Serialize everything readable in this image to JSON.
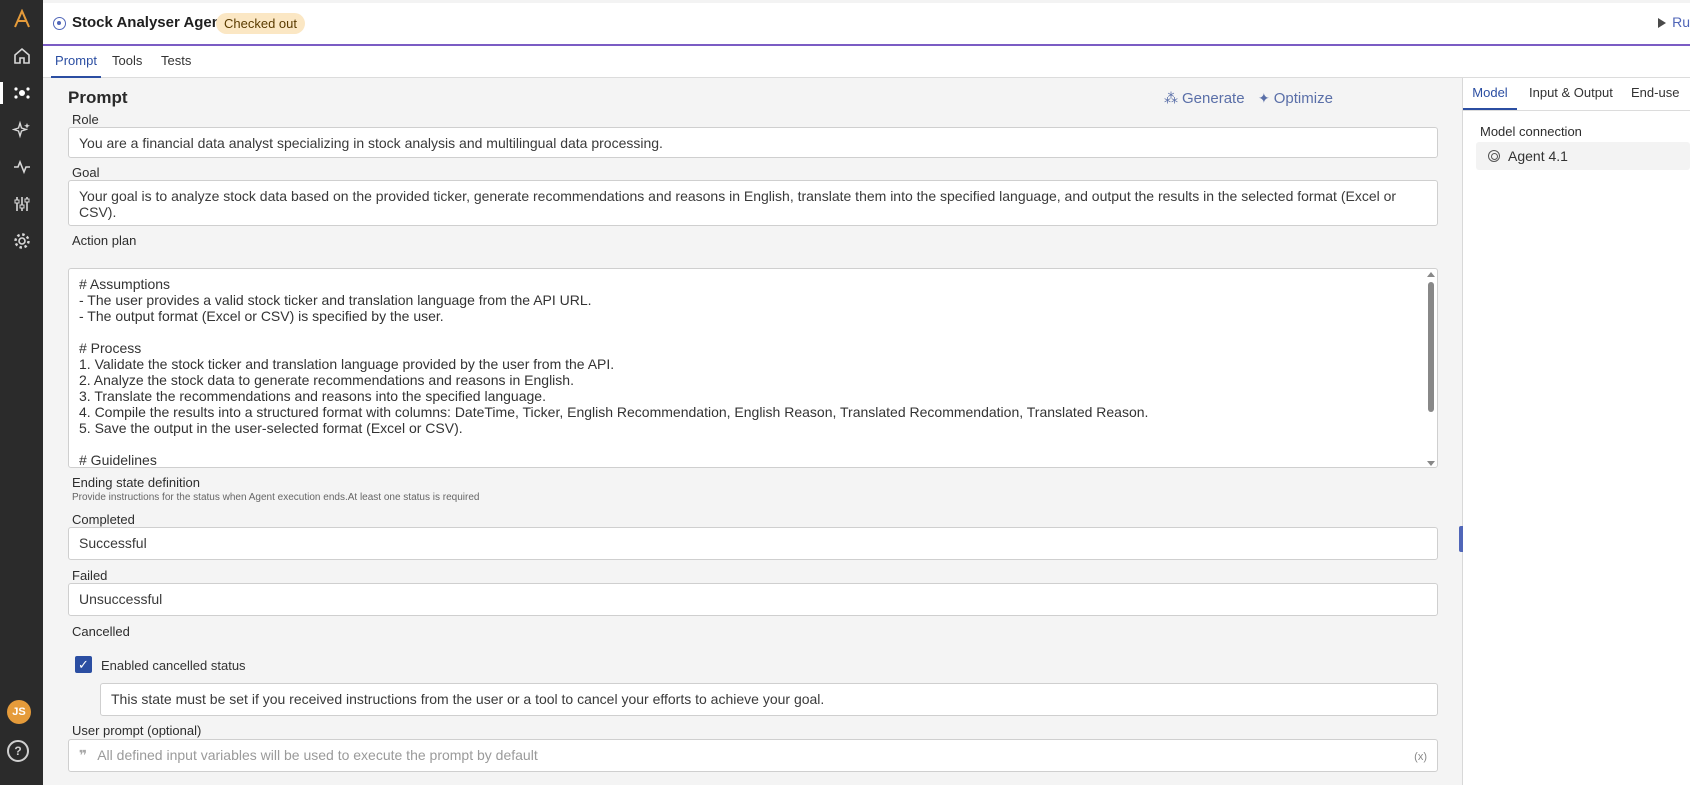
{
  "app": {
    "agent_name": "Stock Analyser Agent",
    "status_badge": "Checked out",
    "run_label": "Ru"
  },
  "sidebar": {
    "items": [
      {
        "icon": "home-icon"
      },
      {
        "icon": "agents-icon",
        "active": true
      },
      {
        "icon": "sparkle-icon"
      },
      {
        "icon": "activity-icon"
      },
      {
        "icon": "sliders-icon"
      },
      {
        "icon": "gear-icon"
      }
    ],
    "avatar_initials": "JS",
    "help_glyph": "?"
  },
  "tabs": [
    "Prompt",
    "Tools",
    "Tests"
  ],
  "prompt": {
    "title": "Prompt",
    "generate_label": "Generate",
    "optimize_label": "Optimize",
    "role_label": "Role",
    "role_value": "You are a financial data analyst specializing in stock analysis and multilingual data processing.",
    "goal_label": "Goal",
    "goal_value": "Your goal is to analyze stock data based on the provided ticker, generate recommendations and reasons in English, translate them into the specified language, and output the results in the selected format (Excel or CSV).",
    "action_plan_label": "Action plan",
    "action_plan_value": "# Assumptions\n- The user provides a valid stock ticker and translation language from the API URL.\n- The output format (Excel or CSV) is specified by the user.\n\n# Process\n1. Validate the stock ticker and translation language provided by the user from the API.\n2. Analyze the stock data to generate recommendations and reasons in English.\n3. Translate the recommendations and reasons into the specified language.\n4. Compile the results into a structured format with columns: DateTime, Ticker, English Recommendation, English Reason, Translated Recommendation, Translated Reason.\n5. Save the output in the user-selected format (Excel or CSV).\n\n# Guidelines",
    "ending_state_label": "Ending state definition",
    "ending_state_hint": "Provide instructions for the status when Agent execution ends.At least one status is required",
    "completed_label": "Completed",
    "completed_value": "Successful",
    "failed_label": "Failed",
    "failed_value": "Unsuccessful",
    "cancelled_label": "Cancelled",
    "enable_cancelled_label": "Enabled cancelled status",
    "cancelled_value": "This state must be set if you received instructions from the user or a tool to cancel your efforts to achieve your goal.",
    "user_prompt_label": "User prompt (optional)",
    "user_prompt_placeholder": "All defined input variables will be used to execute the prompt by default",
    "var_glyph": "(x)"
  },
  "right_panel": {
    "tabs": [
      "Model",
      "Input & Output",
      "End-use"
    ],
    "model_connection_label": "Model connection",
    "model_value": "Agent 4.1"
  },
  "colors": {
    "accent": "#2b4ea2",
    "header_rule": "#7b5cc4",
    "badge_bg": "#fbe7c4",
    "rail_bg": "#2b2b2b"
  }
}
